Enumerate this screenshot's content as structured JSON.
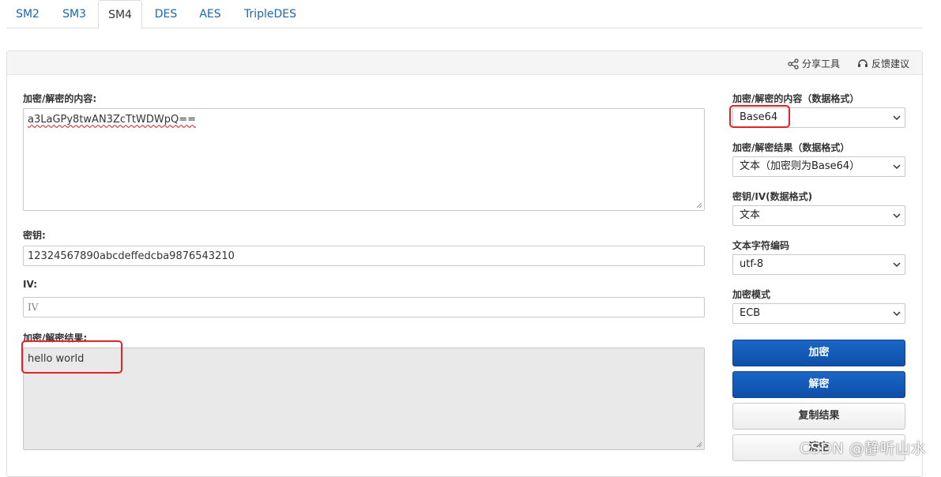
{
  "tabs": [
    {
      "label": "SM2",
      "active": false
    },
    {
      "label": "SM3",
      "active": false
    },
    {
      "label": "SM4",
      "active": true
    },
    {
      "label": "DES",
      "active": false
    },
    {
      "label": "AES",
      "active": false
    },
    {
      "label": "TripleDES",
      "active": false
    }
  ],
  "header": {
    "share_label": "分享工具",
    "feedback_label": "反馈建议"
  },
  "main": {
    "content_label": "加密/解密的内容:",
    "content_value": "a3LaGPy8twAN3ZcTtWDWpQ==",
    "key_label": "密钥:",
    "key_value": "12324567890abcdeffedcba9876543210",
    "iv_label": "IV:",
    "iv_placeholder": "IV",
    "result_label": "加密/解密结果:",
    "result_value": "hello world"
  },
  "options": {
    "content_format_label": "加密/解密的内容（数据格式）",
    "content_format_value": "Base64",
    "result_format_label": "加密/解密结果（数据格式）",
    "result_format_value": "文本（加密则为Base64）",
    "key_format_label": "密钥/IV(数据格式)",
    "key_format_value": "文本",
    "charset_label": "文本字符编码",
    "charset_value": "utf-8",
    "mode_label": "加密模式",
    "mode_value": "ECB"
  },
  "buttons": {
    "encrypt": "加密",
    "decrypt": "解密",
    "copy": "复制结果",
    "clear": "清空"
  },
  "watermark": "CSDN @静听山水",
  "colors": {
    "tab_link": "#1a66b3",
    "primary_button": "#1b66c7",
    "highlight": "#e0242b",
    "result_background": "#e9e9e9"
  }
}
